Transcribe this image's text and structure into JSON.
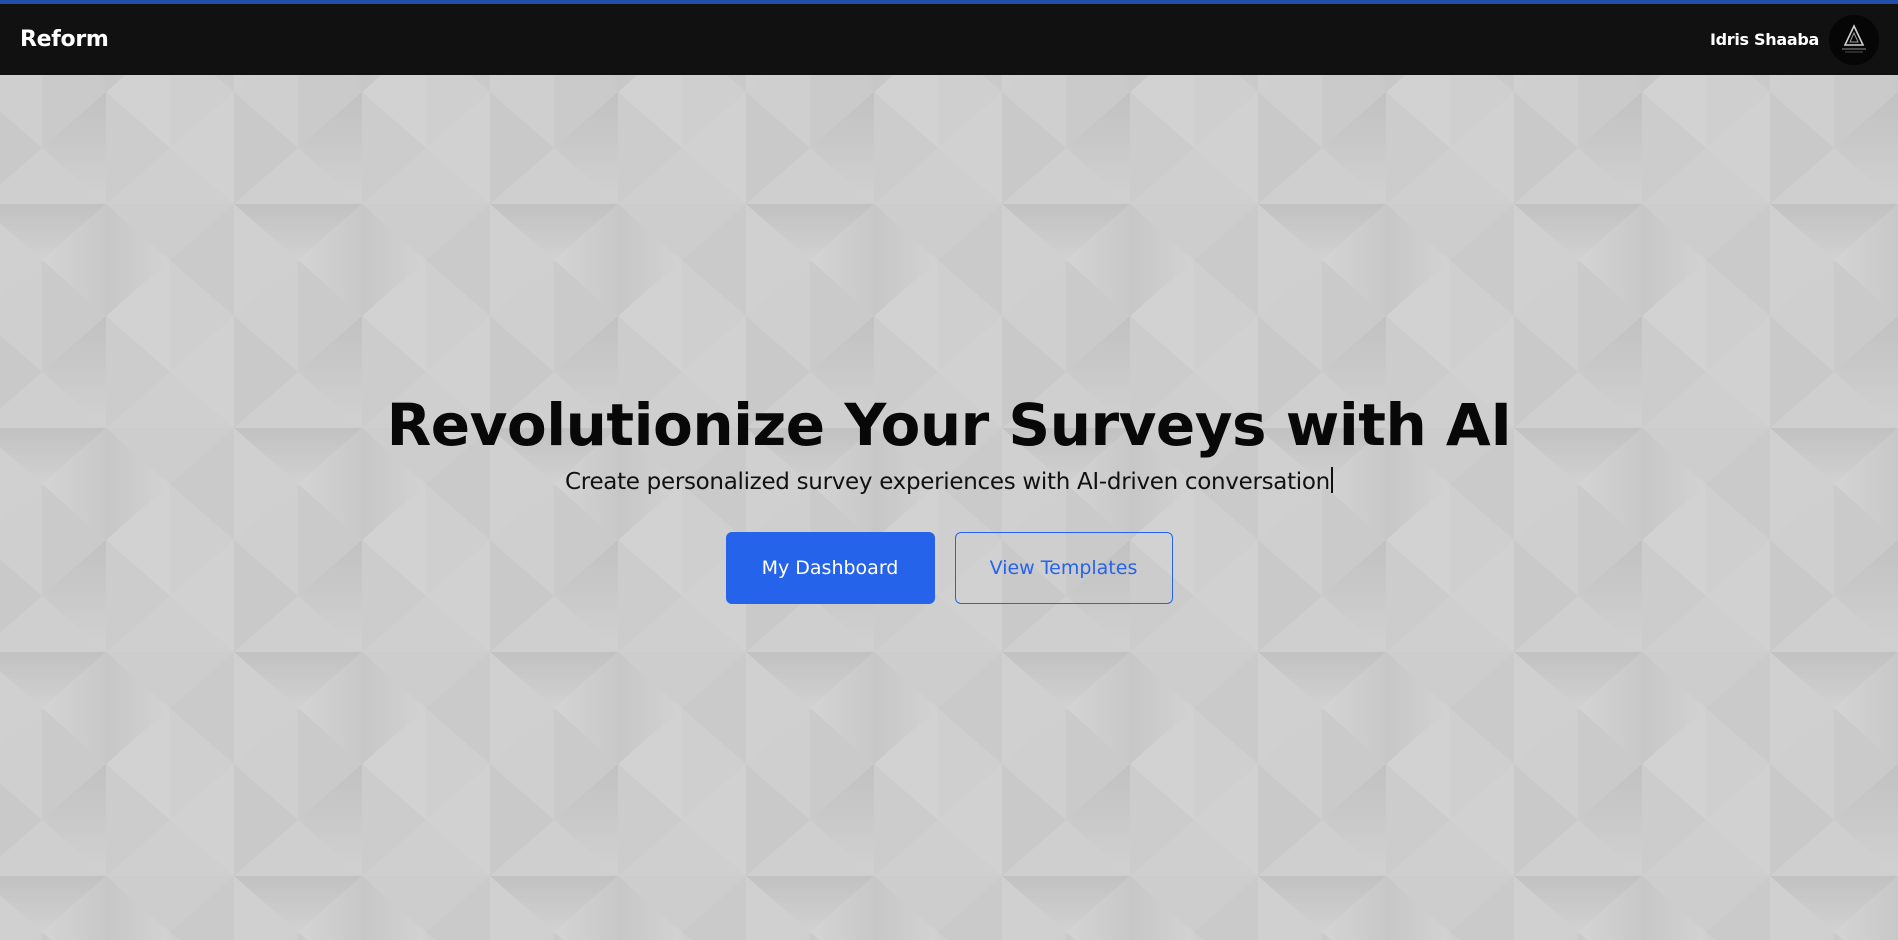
{
  "navbar": {
    "brand": "Reform",
    "user_name": "Idris Shaaba",
    "avatar_icon": "avatar-emblem-icon"
  },
  "hero": {
    "title": "Revolutionize Your Surveys with AI",
    "subtitle": "Create personalized survey experiences with AI-driven conversation",
    "primary_button": "My Dashboard",
    "secondary_button": "View Templates"
  },
  "colors": {
    "accent": "#2563eb",
    "navbar_bg": "#111111",
    "top_accent": "#1f4fa8",
    "hero_bg": "#cfcfcf"
  }
}
